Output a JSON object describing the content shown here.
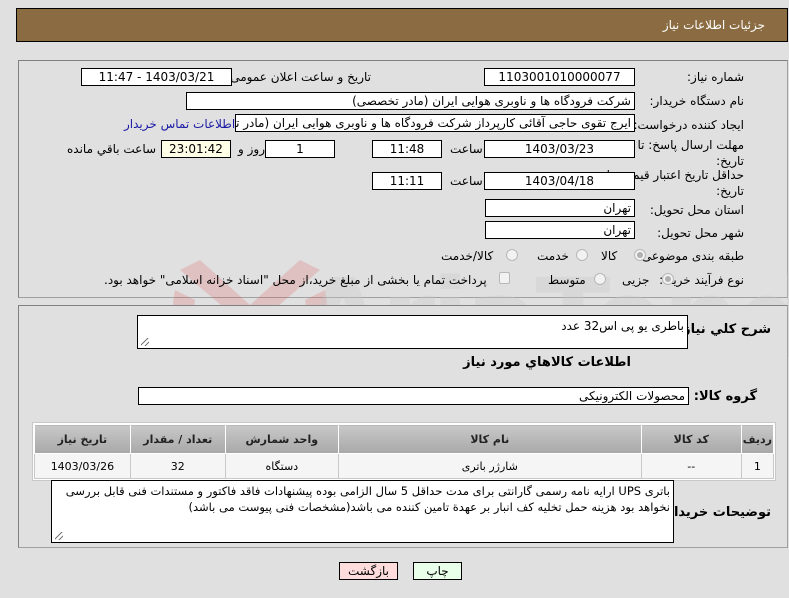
{
  "header": {
    "title": "جزئیات اطلاعات نیاز"
  },
  "form": {
    "need_number": {
      "label": "شماره نیاز:",
      "value": "1103001010000077"
    },
    "announce_datetime": {
      "label": "تاریخ و ساعت اعلان عمومی:",
      "value": "1403/03/21 - 11:47"
    },
    "buyer_org": {
      "label": "نام دستگاه خریدار:",
      "value": "شرکت فرودگاه ها و ناوبری هوایی ایران (مادر تخصصی)"
    },
    "requester": {
      "label": "ایجاد کننده درخواست:",
      "value": "ایرج تقوی حاجی آقائی کارپرداز شرکت فرودگاه ها و ناوبری هوایی ایران (مادر تخصصی)",
      "contact_link": "اطلاعات تماس خریدار"
    },
    "reply_deadline": {
      "label_line1": "مهلت ارسال پاسخ: تا",
      "label_line2": "تاریخ:",
      "date": "1403/03/23",
      "time_label": "ساعت",
      "time": "11:48",
      "days": "1",
      "days_label": "روز و",
      "remaining": "23:01:42",
      "remaining_label": "ساعت باقي مانده"
    },
    "price_validity": {
      "label_line1": "حداقل تاریخ اعتبار قیمت: تا",
      "label_line2": "تاریخ:",
      "date": "1403/04/18",
      "time_label": "ساعت",
      "time": "11:11"
    },
    "province": {
      "label": "استان محل تحویل:",
      "value": "تهران"
    },
    "city": {
      "label": "شهر محل تحویل:",
      "value": "تهران"
    },
    "category": {
      "label": "طبقه بندی موضوعی:",
      "options": [
        "کالا",
        "خدمت",
        "کالا/خدمت"
      ],
      "selected": "کالا"
    },
    "purchase_type": {
      "label": "نوع فرآیند خرید :",
      "options": [
        "جزیی",
        "متوسط"
      ],
      "selected": "جزیی",
      "treasury_note": "پرداخت تمام یا بخشی از مبلغ خرید،از محل \"اسناد خزانه اسلامی\" خواهد بود."
    }
  },
  "details": {
    "description_label": "شرح کلي نياز:",
    "description": "باطری یو پی اس32 عدد",
    "goods_section_title": "اطلاعات کالاهاي مورد نياز",
    "goods_group_label": "گروه کالا:",
    "goods_group": "محصولات الکترونیکی",
    "table": {
      "headers": [
        "ردیف",
        "کد کالا",
        "نام کالا",
        "واحد شمارش",
        "تعداد / مقدار",
        "تاریخ نیاز"
      ],
      "rows": [
        [
          "1",
          "--",
          "شارژر باتری",
          "دستگاه",
          "32",
          "1403/03/26"
        ]
      ]
    },
    "buyer_notes_label": "توضیحات خریدار:",
    "buyer_notes": "باتری UPS ارایه نامه رسمی گارانتی برای مدت حداقل 5 سال الزامی بوده پیشنهادات فاقد فاکتور و مستندات فنی قابل بررسی نخواهد بود هزینه حمل تخلیه کف انبار بر عهدة تامین کننده می باشد(مشخصات فنی پیوست می باشد)"
  },
  "buttons": {
    "print": "چاپ",
    "back": "بازگشت"
  },
  "watermark": {
    "text": "AriaTender.neT"
  },
  "colors": {
    "header_bg": "#8b6c42",
    "print_bg": "#eaffea",
    "back_bg": "#ffdcdc",
    "link": "#1a1aa6"
  }
}
